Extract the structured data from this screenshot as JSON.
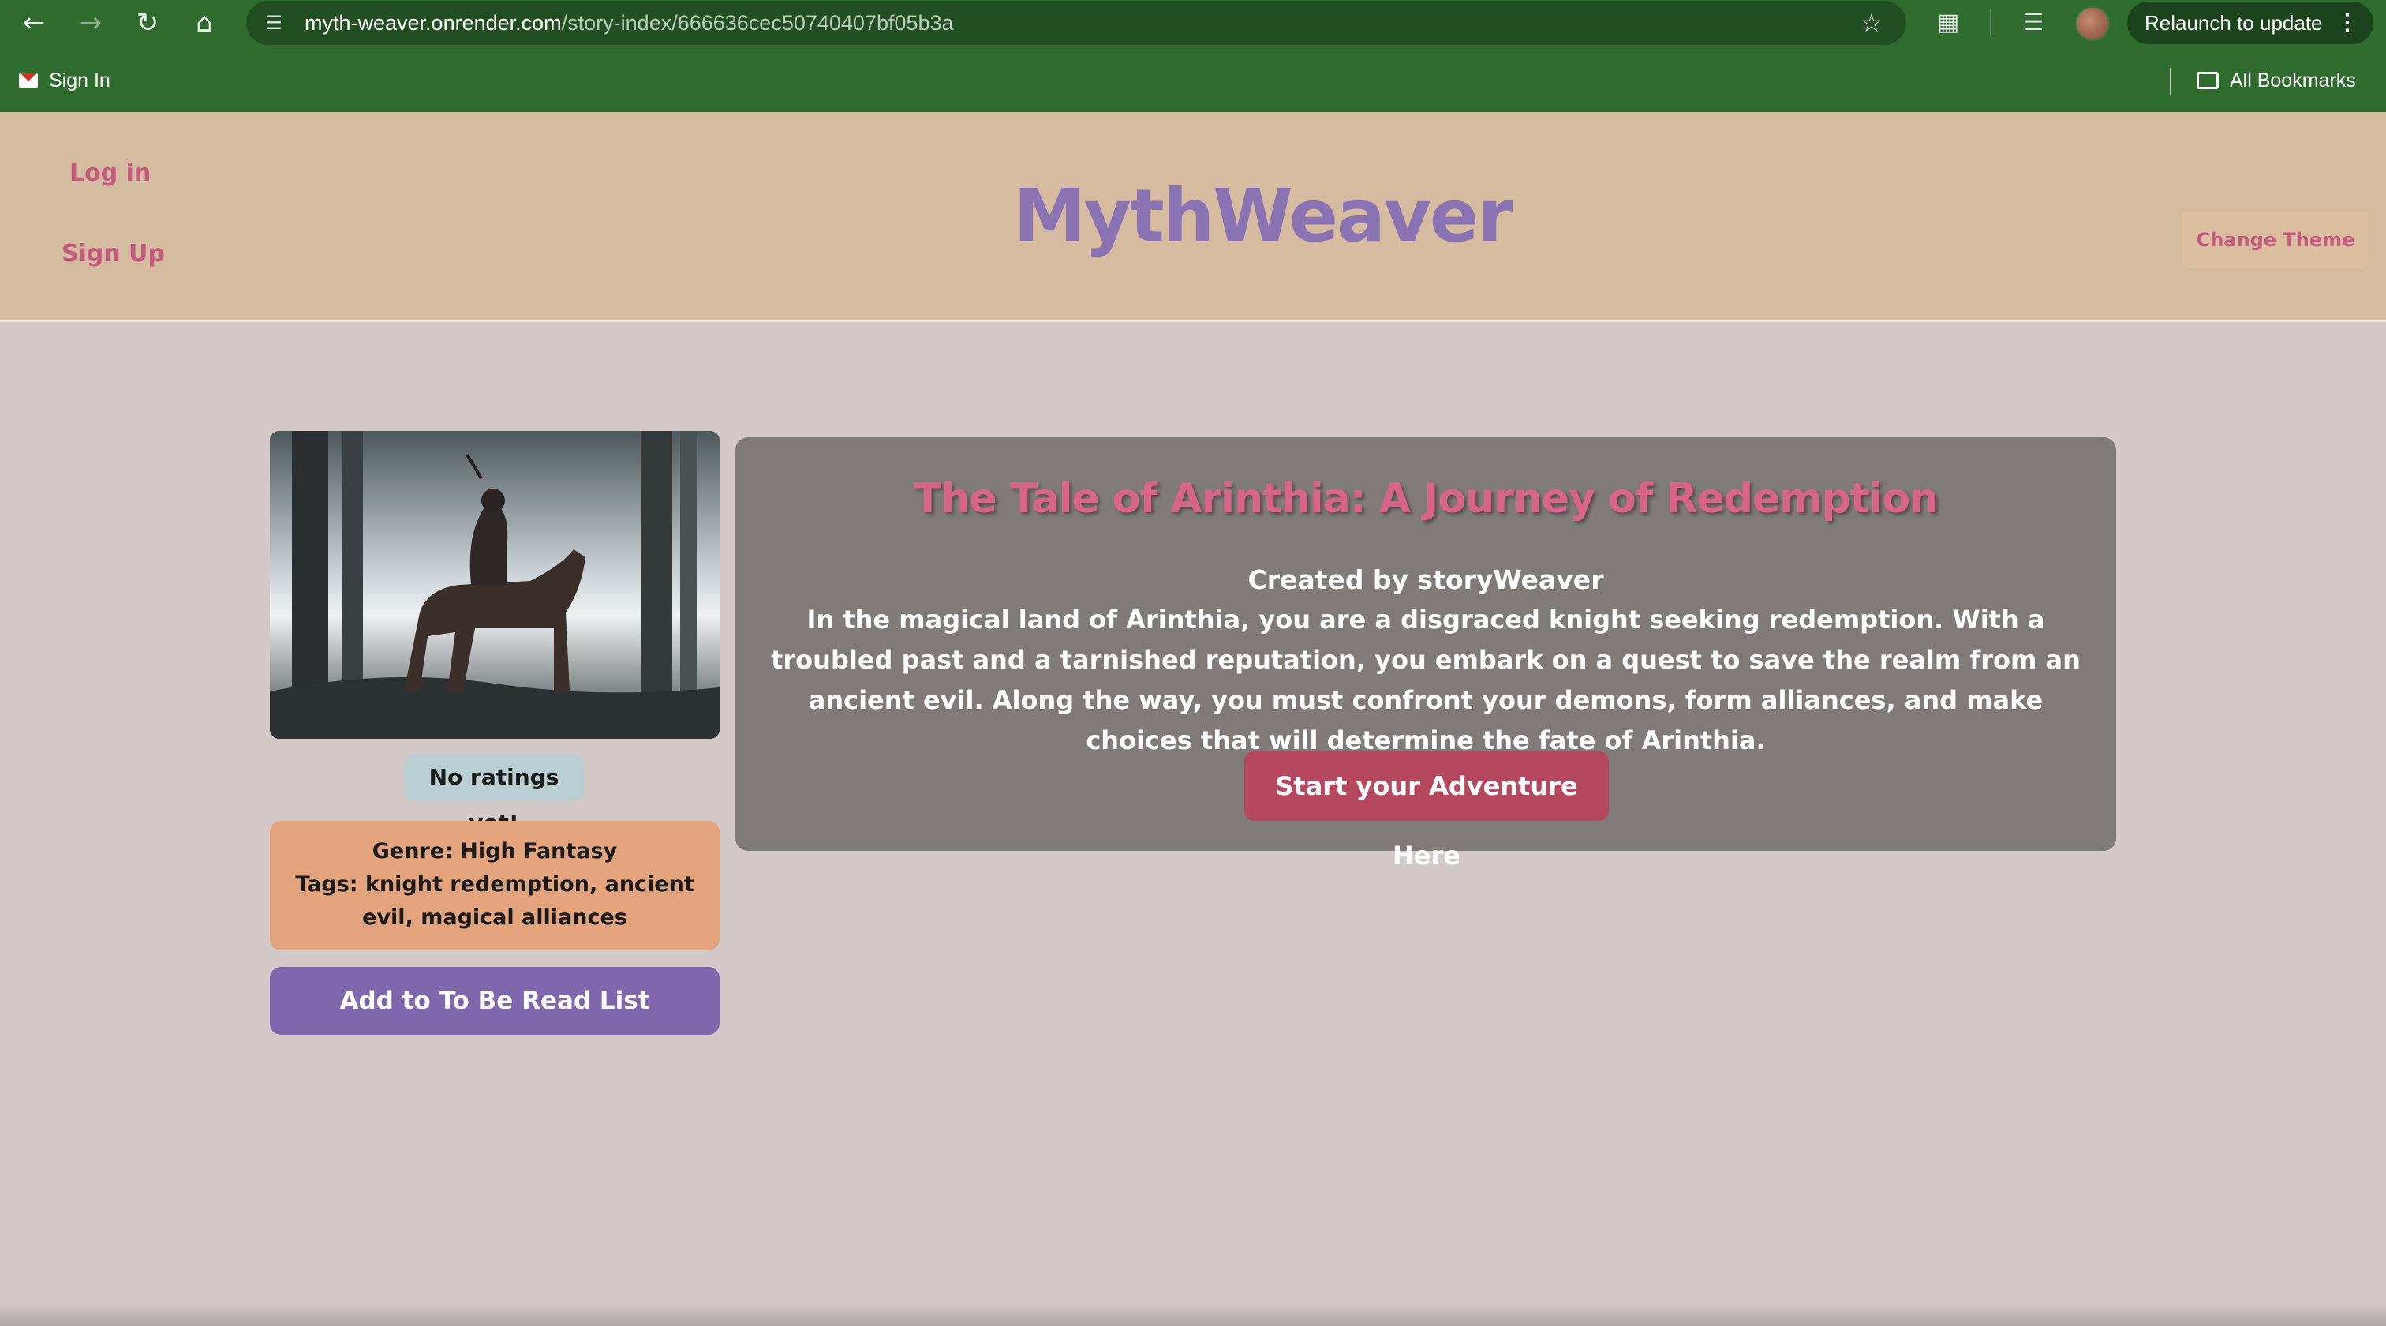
{
  "browser": {
    "url_host": "myth-weaver.onrender.com",
    "url_path": "/story-index/666636cec50740407bf05b3a",
    "relaunch_label": "Relaunch to update",
    "bookmarks": {
      "sign_in": "Sign In",
      "all_bookmarks": "All Bookmarks"
    }
  },
  "header": {
    "login": "Log in",
    "signup": "Sign Up",
    "brand": "MythWeaver",
    "change_theme": "Change Theme"
  },
  "story": {
    "title": "The Tale of Arinthia: A Journey of Redemption",
    "author_line": "Created by storyWeaver",
    "description": "In the magical land of Arinthia, you are a disgraced knight seeking redemption. With a troubled past and a tarnished reputation, you embark on a quest to save the realm from an ancient evil. Along the way, you must confront your demons, form alliances, and make choices that will determine the fate of Arinthia.",
    "start_button": "Start your Adventure Here",
    "rating": "No ratings yet!",
    "genre": "Genre: High Fantasy",
    "tags": "Tags: knight redemption, ancient evil, magical alliances",
    "tbr_button": "Add to To Be Read List"
  },
  "colors": {
    "chrome": "#2f6a2f",
    "header_bg": "#d5bb9f",
    "brand": "#8b72b3",
    "link": "#c45a7d",
    "card_bg": "#807a78",
    "title": "#d8648a",
    "start_button": "#b5475e",
    "genre_bg": "#e3a47e",
    "tbr_bg": "#7e67ad",
    "rating_bg": "#b9cfd1",
    "page_bg": "#d3c9c8"
  },
  "icons": {
    "back": "arrow-left-icon",
    "forward": "arrow-right-icon",
    "reload": "reload-icon",
    "home": "home-icon",
    "site_info": "tune-icon",
    "bookmark": "star-icon",
    "extensions": "puzzle-icon",
    "media": "queue-music-icon",
    "menu": "kebab-icon"
  }
}
